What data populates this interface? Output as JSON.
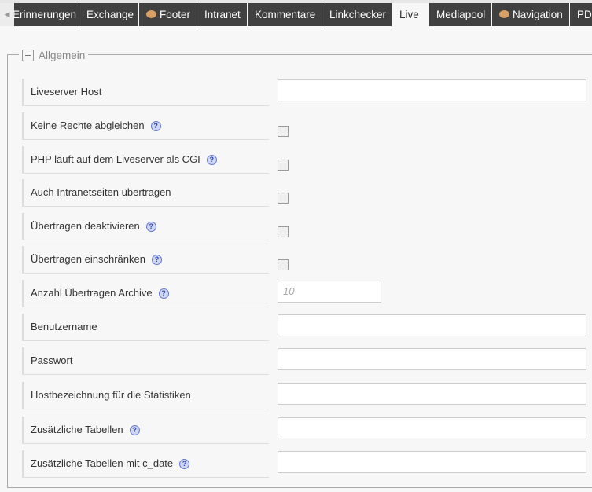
{
  "tabs": [
    {
      "label": "Erinnerungen",
      "icon": null
    },
    {
      "label": "Exchange",
      "icon": null
    },
    {
      "label": "Footer",
      "icon": "palette-icon"
    },
    {
      "label": "Intranet",
      "icon": null
    },
    {
      "label": "Kommentare",
      "icon": null
    },
    {
      "label": "Linkchecker",
      "icon": null
    },
    {
      "label": "Live",
      "icon": null,
      "active": true
    },
    {
      "label": "Mediapool",
      "icon": null
    },
    {
      "label": "Navigation",
      "icon": "palette-icon"
    },
    {
      "label": "PDF",
      "icon": null
    }
  ],
  "fieldset": {
    "legend": "Allgemein"
  },
  "fields": [
    {
      "label": "Liveserver Host",
      "type": "text",
      "help": false,
      "value": ""
    },
    {
      "label": "Keine Rechte abgleichen",
      "type": "checkbox",
      "help": true,
      "checked": false
    },
    {
      "label": "PHP läuft auf dem Liveserver als CGI",
      "type": "checkbox",
      "help": true,
      "checked": false
    },
    {
      "label": "Auch Intranetseiten übertragen",
      "type": "checkbox",
      "help": false,
      "checked": false
    },
    {
      "label": "Übertragen deaktivieren",
      "type": "checkbox",
      "help": true,
      "checked": false
    },
    {
      "label": "Übertragen einschränken",
      "type": "checkbox",
      "help": true,
      "checked": false
    },
    {
      "label": "Anzahl Übertragen Archive",
      "type": "short",
      "help": true,
      "placeholder": "10"
    },
    {
      "label": "Benutzername",
      "type": "text",
      "help": false,
      "value": ""
    },
    {
      "label": "Passwort",
      "type": "text",
      "help": false,
      "value": ""
    },
    {
      "label": "Hostbezeichnung für die Statistiken",
      "type": "text",
      "help": false,
      "value": ""
    },
    {
      "label": "Zusätzliche Tabellen",
      "type": "text",
      "help": true,
      "value": ""
    },
    {
      "label": "Zusätzliche Tabellen mit c_date",
      "type": "text",
      "help": true,
      "value": ""
    }
  ],
  "help_glyph": "?"
}
